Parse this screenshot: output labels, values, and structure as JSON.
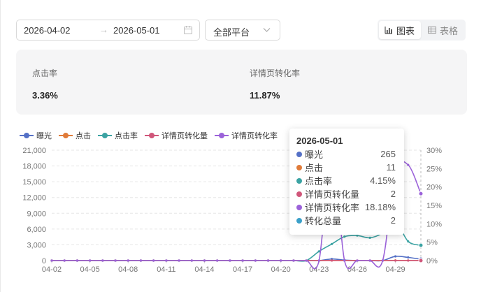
{
  "filters": {
    "date_start": "2026-04-02",
    "date_arrow": "→",
    "date_end": "2026-05-01",
    "platform": "全部平台"
  },
  "view_toggle": {
    "chart_label": "图表",
    "table_label": "表格"
  },
  "metrics": [
    {
      "label": "点击率",
      "value": "3.36%"
    },
    {
      "label": "详情页转化率",
      "value": "11.87%"
    }
  ],
  "colors": {
    "曝光": "#5470c6",
    "点击": "#e07b39",
    "点击率": "#3ba3a3",
    "详情页转化量": "#d0567a",
    "详情页转化率": "#9b62d9",
    "转化总量": "#3aa0c9"
  },
  "chart_data": {
    "type": "line",
    "x": [
      "04-02",
      "04-03",
      "04-04",
      "04-05",
      "04-06",
      "04-07",
      "04-08",
      "04-09",
      "04-10",
      "04-11",
      "04-12",
      "04-13",
      "04-14",
      "04-15",
      "04-16",
      "04-17",
      "04-18",
      "04-19",
      "04-20",
      "04-21",
      "04-22",
      "04-23",
      "04-24",
      "04-25",
      "04-26",
      "04-27",
      "04-28",
      "04-29",
      "04-30",
      "05-01"
    ],
    "x_tick_labels": [
      "04-02",
      "04-05",
      "04-08",
      "04-11",
      "04-14",
      "04-17",
      "04-20",
      "04-23",
      "04-26",
      "04-29"
    ],
    "y_left": {
      "ticks": [
        "0",
        "3,000",
        "6,000",
        "9,000",
        "12,000",
        "15,000",
        "18,000",
        "21,000"
      ],
      "range": [
        0,
        21000
      ]
    },
    "y_right": {
      "ticks": [
        "0%",
        "5%",
        "10%",
        "15%",
        "20%",
        "25%",
        "30%"
      ],
      "range": [
        0,
        30
      ]
    },
    "legend": [
      "曝光",
      "点击",
      "点击率",
      "详情页转化量",
      "详情页转化率"
    ],
    "legend_position": "top-left",
    "grid": true,
    "series": [
      {
        "name": "曝光",
        "axis": "left",
        "values": [
          0,
          0,
          0,
          0,
          0,
          0,
          0,
          0,
          0,
          0,
          0,
          0,
          0,
          0,
          0,
          0,
          0,
          0,
          0,
          0,
          0,
          0,
          300,
          100,
          0,
          0,
          0,
          800,
          600,
          265
        ]
      },
      {
        "name": "点击",
        "axis": "left",
        "values": [
          0,
          0,
          0,
          0,
          0,
          0,
          0,
          0,
          0,
          0,
          0,
          0,
          0,
          0,
          0,
          0,
          0,
          0,
          0,
          0,
          0,
          0,
          20,
          5,
          0,
          0,
          0,
          30,
          20,
          11
        ]
      },
      {
        "name": "点击率",
        "axis": "right",
        "values": [
          0,
          0,
          0,
          0,
          0,
          0,
          0,
          0,
          0,
          0,
          0,
          0,
          0,
          0,
          0,
          0,
          0,
          0,
          0,
          0,
          0,
          2.5,
          4.5,
          6.5,
          6.8,
          6.2,
          7.5,
          10.5,
          5.2,
          4.15
        ]
      },
      {
        "name": "详情页转化量",
        "axis": "left",
        "values": [
          0,
          0,
          0,
          0,
          0,
          0,
          0,
          0,
          0,
          0,
          0,
          0,
          0,
          0,
          0,
          0,
          0,
          0,
          0,
          0,
          0,
          0,
          5,
          0,
          0,
          0,
          0,
          4,
          3,
          2
        ]
      },
      {
        "name": "详情页转化率",
        "axis": "right",
        "values": [
          0,
          0,
          0,
          0,
          0,
          0,
          0,
          0,
          0,
          0,
          0,
          0,
          0,
          0,
          0,
          0,
          0,
          0,
          0,
          0,
          0,
          0,
          30,
          0,
          0,
          0,
          0,
          24,
          26,
          18.18
        ]
      }
    ]
  },
  "tooltip": {
    "title": "2026-05-01",
    "rows": [
      {
        "name": "曝光",
        "value": "265",
        "color": "#5470c6"
      },
      {
        "name": "点击",
        "value": "11",
        "color": "#e07b39"
      },
      {
        "name": "点击率",
        "value": "4.15%",
        "color": "#3ba3a3"
      },
      {
        "name": "详情页转化量",
        "value": "2",
        "color": "#d0567a"
      },
      {
        "name": "详情页转化率",
        "value": "18.18%",
        "color": "#9b62d9"
      },
      {
        "name": "转化总量",
        "value": "2",
        "color": "#3aa0c9"
      }
    ]
  }
}
